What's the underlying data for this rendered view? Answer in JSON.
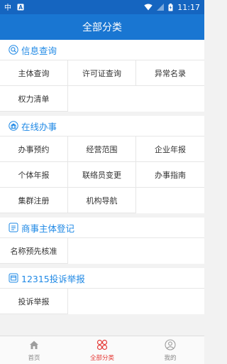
{
  "status": {
    "time": "11:17"
  },
  "header": {
    "title": "全部分类"
  },
  "sections": [
    {
      "title": "信息查询",
      "icon": "search-icon",
      "items": [
        "主体查询",
        "许可证查询",
        "异常名录",
        "权力清单"
      ]
    },
    {
      "title": "在线办事",
      "icon": "building-icon",
      "items": [
        "办事预约",
        "经营范围",
        "企业年报",
        "个体年报",
        "联络员变更",
        "办事指南",
        "集群注册",
        "机构导航"
      ]
    },
    {
      "title": "商事主体登记",
      "icon": "document-icon",
      "items": [
        "名称预先核准"
      ]
    },
    {
      "title": "12315投诉举报",
      "icon": "report-icon",
      "items": [
        "投诉举报"
      ]
    }
  ],
  "tabs": [
    {
      "label": "首页",
      "icon": "home-icon",
      "active": false
    },
    {
      "label": "全部分类",
      "icon": "category-icon",
      "active": true
    },
    {
      "label": "我的",
      "icon": "profile-icon",
      "active": false
    }
  ],
  "colors": {
    "accent": "#1976d2",
    "statusbar": "#1565c0",
    "active_tab": "#e53935",
    "section_title": "#1e88e5"
  }
}
